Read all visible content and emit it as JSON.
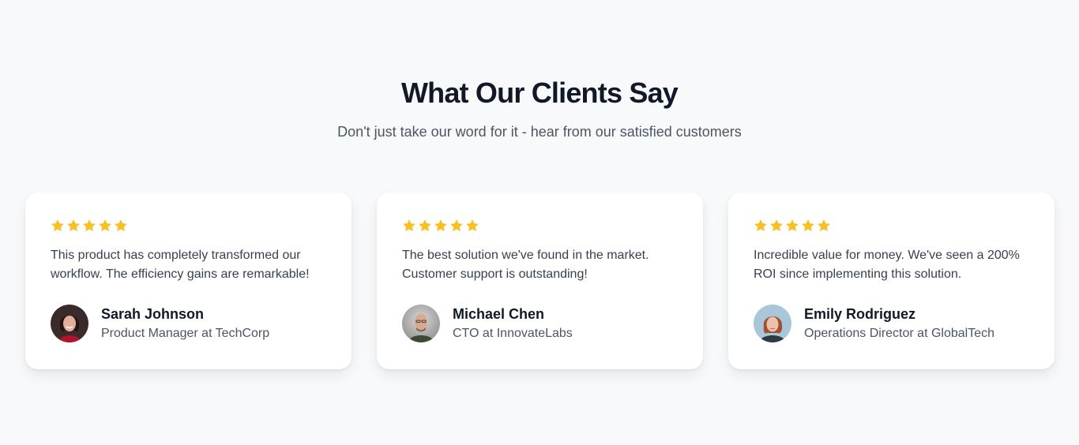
{
  "section": {
    "title": "What Our Clients Say",
    "subtitle": "Don't just take our word for it - hear from our satisfied customers"
  },
  "colors": {
    "star": "#fbbf24",
    "title": "#111827",
    "text": "#374151",
    "muted": "#4b5563",
    "background": "#f8f9fb"
  },
  "testimonials": [
    {
      "rating": 5,
      "quote": "This product has completely transformed our workflow. The efficiency gains are remarkable!",
      "name": "Sarah Johnson",
      "role": "Product Manager at TechCorp",
      "avatar_icon": "avatar-photo-woman-dark-hair"
    },
    {
      "rating": 5,
      "quote": "The best solution we've found in the market. Customer support is outstanding!",
      "name": "Michael Chen",
      "role": "CTO at InnovateLabs",
      "avatar_icon": "avatar-photo-man-bald"
    },
    {
      "rating": 5,
      "quote": "Incredible value for money. We've seen a 200% ROI since implementing this solution.",
      "name": "Emily Rodriguez",
      "role": "Operations Director at GlobalTech",
      "avatar_icon": "avatar-photo-woman-red-hair"
    }
  ]
}
